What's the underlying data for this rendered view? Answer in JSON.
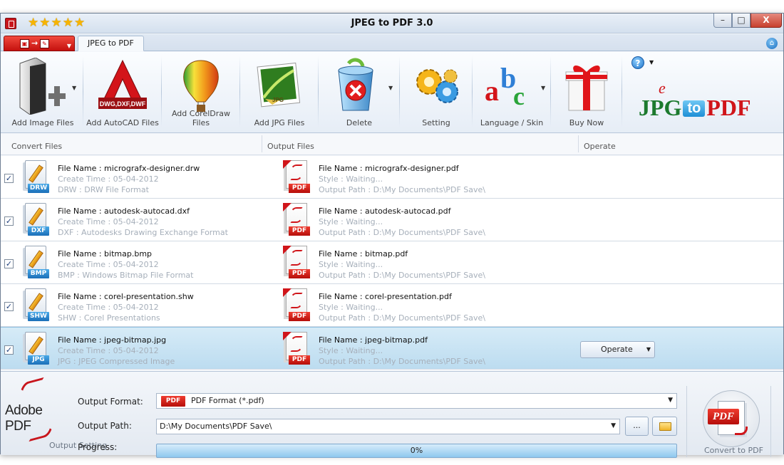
{
  "window": {
    "title": "JPEG to PDF 3.0",
    "stars": "★★★★★",
    "min_label": "–",
    "max_label": "□",
    "close_label": "X"
  },
  "ribbon": {
    "tab": "JPEG to PDF"
  },
  "toolbar": {
    "items": [
      {
        "label": "Add Image Files",
        "icon": "add-image-files-icon"
      },
      {
        "label": "Add AutoCAD Files",
        "icon": "autocad-icon",
        "sub": "DWG,DXF,DWF"
      },
      {
        "label": "Add CorelDraw Files",
        "icon": "balloon-icon"
      },
      {
        "label": "Add JPG Files",
        "icon": "jpg-image-icon"
      },
      {
        "label": "Delete",
        "icon": "recycle-bin-icon"
      },
      {
        "label": "Setting",
        "icon": "gears-icon"
      },
      {
        "label": "Language / Skin",
        "icon": "abc-icon",
        "letters": [
          "a",
          "b",
          "c"
        ]
      },
      {
        "label": "Buy Now",
        "icon": "gift-icon"
      }
    ],
    "help_label": "?",
    "logo": {
      "jpg": "JPG",
      "to": "to",
      "pdf": "PDF",
      "e": "e"
    }
  },
  "columns": {
    "convert": "Convert Files",
    "output": "Output Files",
    "operate": "Operate"
  },
  "files": [
    {
      "checked": "✓",
      "src_tag": "DRW",
      "src_name": "File Name : micrografx-designer.drw",
      "src_time": "Create Time : 05-04-2012",
      "src_type": "DRW : DRW File Format",
      "out_name": "File Name : micrografx-designer.pdf",
      "out_style": "Style : Waiting...",
      "out_path": "Output Path : D:\\My Documents\\PDF Save\\",
      "out_tag": "PDF"
    },
    {
      "checked": "✓",
      "src_tag": "DXF",
      "src_name": "File Name : autodesk-autocad.dxf",
      "src_time": "Create Time : 05-04-2012",
      "src_type": "DXF : Autodesks Drawing Exchange Format",
      "out_name": "File Name : autodesk-autocad.pdf",
      "out_style": "Style : Waiting...",
      "out_path": "Output Path : D:\\My Documents\\PDF Save\\",
      "out_tag": "PDF"
    },
    {
      "checked": "✓",
      "src_tag": "BMP",
      "src_name": "File Name : bitmap.bmp",
      "src_time": "Create Time : 05-04-2012",
      "src_type": "BMP : Windows Bitmap File Format",
      "out_name": "File Name : bitmap.pdf",
      "out_style": "Style : Waiting...",
      "out_path": "Output Path : D:\\My Documents\\PDF Save\\",
      "out_tag": "PDF"
    },
    {
      "checked": "✓",
      "src_tag": "SHW",
      "src_name": "File Name : corel-presentation.shw",
      "src_time": "Create Time : 05-04-2012",
      "src_type": "SHW : Corel Presentations",
      "out_name": "File Name : corel-presentation.pdf",
      "out_style": "Style : Waiting...",
      "out_path": "Output Path : D:\\My Documents\\PDF Save\\",
      "out_tag": "PDF"
    },
    {
      "checked": "✓",
      "src_tag": "JPG",
      "src_name": "File Name : jpeg-bitmap.jpg",
      "src_time": "Create Time : 05-04-2012",
      "src_type": "JPG : JPEG Compressed Image",
      "out_name": "File Name : jpeg-bitmap.pdf",
      "out_style": "Style : Waiting...",
      "out_path": "Output Path : D:\\My Documents\\PDF Save\\",
      "out_tag": "PDF",
      "operate": "Operate"
    }
  ],
  "bottom": {
    "adobe_logo_text": "Adobe PDF",
    "output_format_label": "Output Format:",
    "output_format_badge": "PDF",
    "output_format_value": "PDF Format (*.pdf)",
    "output_path_label": "Output Path:",
    "output_path_value": "D:\\My Documents\\PDF Save\\",
    "browse_label": "...",
    "progress_label": "Progress:",
    "progress_value": "0%",
    "output_setting_label": "Output Setting",
    "convert_badge": "PDF",
    "convert_label": "Convert to PDF"
  }
}
